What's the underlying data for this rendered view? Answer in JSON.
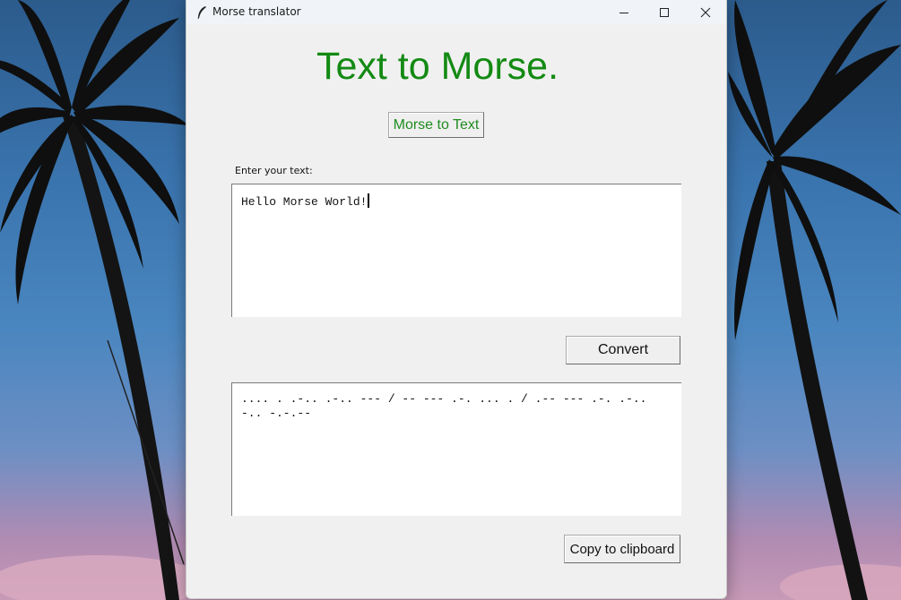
{
  "window": {
    "title": "Morse translator"
  },
  "main": {
    "heading": "Text to Morse.",
    "mode_button_label": "Morse to Text",
    "input_label": "Enter your text:",
    "input_text": "Hello Morse World!",
    "convert_label": "Convert",
    "output_text": ".... . .-.. .-.. --- / -- --- .-. ... . / .-- --- .-. .-.. -.. -.-.--",
    "copy_label": "Copy to clipboard"
  },
  "colors": {
    "heading": "#138a13",
    "mode_button_text": "#1f8c1f",
    "window_bg": "#f0f0f0",
    "textbox_bg": "#ffffff"
  },
  "icons": {
    "app": "feather-icon",
    "minimize": "minimize-icon",
    "maximize": "maximize-icon",
    "close": "close-icon"
  }
}
